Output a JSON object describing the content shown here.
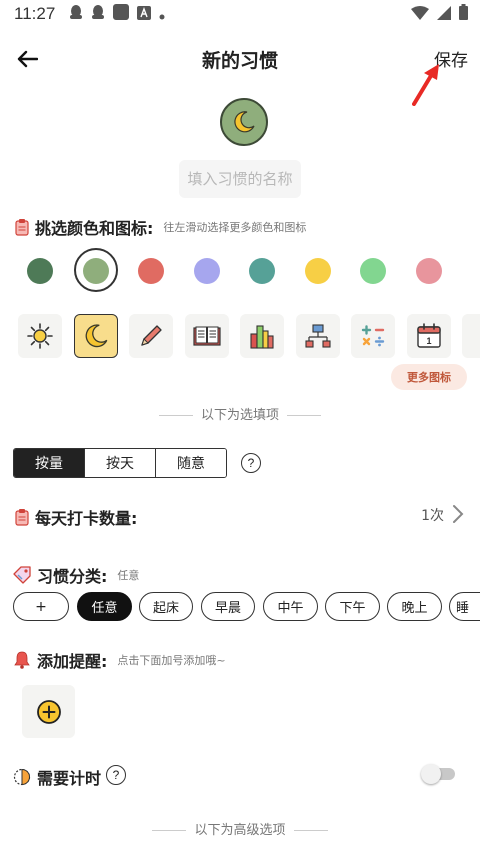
{
  "status_bar": {
    "time": "11:27"
  },
  "header": {
    "title": "新的习惯",
    "save_label": "保存"
  },
  "habit": {
    "icon": "moon-icon",
    "color": "#8fae7c"
  },
  "name_input": {
    "placeholder": "填入习惯的名称",
    "value": ""
  },
  "color_section": {
    "label": "挑选颜色和图标:",
    "hint": "往左滑动选择更多颜色和图标"
  },
  "colors": [
    "#4e7a57",
    "#8fae7c",
    "#e06b62",
    "#a6a6ee",
    "#56a197",
    "#f7cf45",
    "#82d690",
    "#e8959d"
  ],
  "selected_color_index": 1,
  "icon_tiles": [
    "sun-icon",
    "moon-icon",
    "pencil-icon",
    "book-icon",
    "books-icon",
    "network-icon",
    "calculator-icon",
    "calendar-icon"
  ],
  "calendar_tile_text": "1",
  "selected_icon_index": 1,
  "more_icons_label": "更多图标",
  "optional_divider": "以下为选填项",
  "mode_segment": {
    "options": [
      "按量",
      "按天",
      "随意"
    ],
    "active_index": 0,
    "help": "?"
  },
  "daily_count": {
    "label": "每天打卡数量:",
    "value": "1次"
  },
  "category": {
    "label": "习惯分类:",
    "current": "任意",
    "chips": [
      "+",
      "任意",
      "起床",
      "早晨",
      "中午",
      "下午",
      "晚上",
      "睡"
    ],
    "active_index": 1
  },
  "reminder": {
    "label": "添加提醒:",
    "hint": "点击下面加号添加哦~"
  },
  "timer": {
    "label": "需要计时",
    "help": "?",
    "enabled": false
  },
  "advanced_divider": "以下为高级选项"
}
